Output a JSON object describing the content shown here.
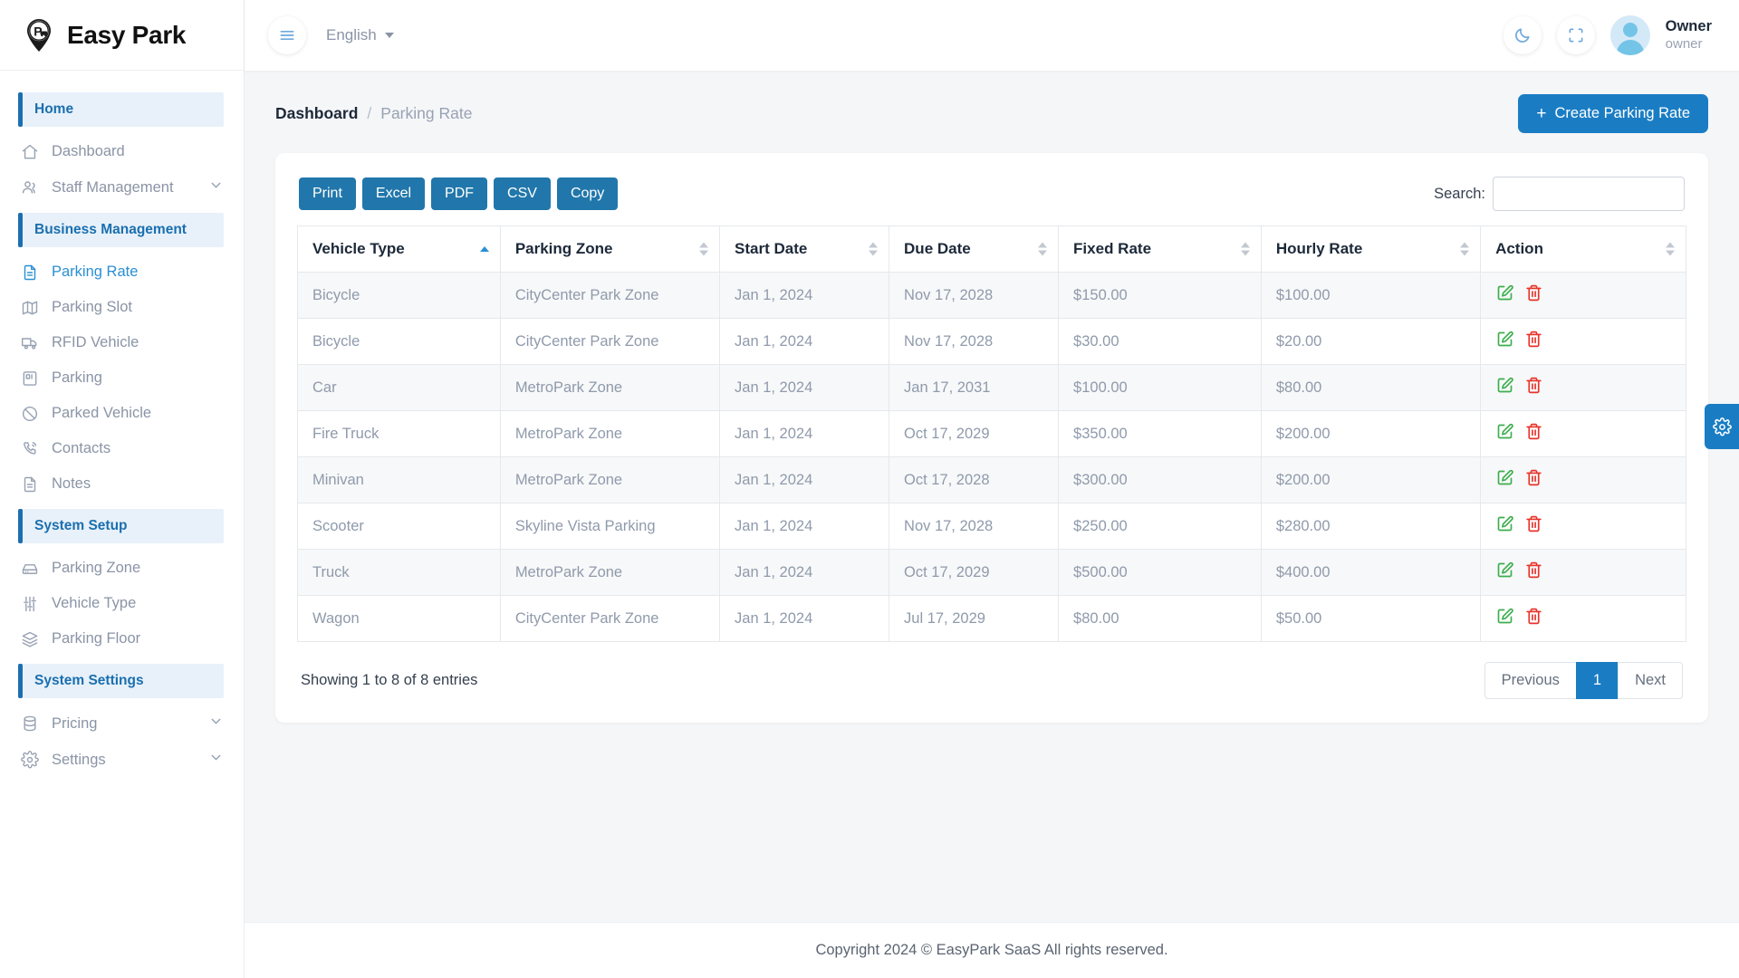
{
  "brand": {
    "name": "Easy Park",
    "logo_icon": "parking-pin-icon"
  },
  "topbar": {
    "menu_icon": "hamburger-menu-icon",
    "language": "English",
    "dark_mode_icon": "moon-icon",
    "fullscreen_icon": "fullscreen-icon",
    "user_name": "Owner",
    "user_role": "owner"
  },
  "sidebar": {
    "groups": [
      {
        "title": "Home",
        "items": [
          {
            "label": "Dashboard",
            "icon": "home-icon",
            "active": false,
            "expandable": false
          },
          {
            "label": "Staff Management",
            "icon": "users-icon",
            "active": false,
            "expandable": true
          }
        ]
      },
      {
        "title": "Business Management",
        "items": [
          {
            "label": "Parking Rate",
            "icon": "file-text-icon",
            "active": true,
            "expandable": false
          },
          {
            "label": "Parking Slot",
            "icon": "map-icon",
            "active": false,
            "expandable": false
          },
          {
            "label": "RFID Vehicle",
            "icon": "truck-icon",
            "active": false,
            "expandable": false
          },
          {
            "label": "Parking",
            "icon": "parking-meter-icon",
            "active": false,
            "expandable": false
          },
          {
            "label": "Parked Vehicle",
            "icon": "ban-icon",
            "active": false,
            "expandable": false
          },
          {
            "label": "Contacts",
            "icon": "phone-call-icon",
            "active": false,
            "expandable": false
          },
          {
            "label": "Notes",
            "icon": "file-text-icon",
            "active": false,
            "expandable": false
          }
        ]
      },
      {
        "title": "System Setup",
        "items": [
          {
            "label": "Parking Zone",
            "icon": "hard-drive-icon",
            "active": false,
            "expandable": false
          },
          {
            "label": "Vehicle Type",
            "icon": "sliders-icon",
            "active": false,
            "expandable": false
          },
          {
            "label": "Parking Floor",
            "icon": "layers-icon",
            "active": false,
            "expandable": false
          }
        ]
      },
      {
        "title": "System Settings",
        "items": [
          {
            "label": "Pricing",
            "icon": "database-icon",
            "active": false,
            "expandable": true
          },
          {
            "label": "Settings",
            "icon": "gear-icon",
            "active": false,
            "expandable": true
          }
        ]
      }
    ]
  },
  "page": {
    "breadcrumb_current": "Dashboard",
    "breadcrumb_sep": "/",
    "breadcrumb_sub": "Parking Rate",
    "create_button": "Create Parking Rate",
    "create_plus": "+"
  },
  "toolbar": {
    "buttons": [
      "Print",
      "Excel",
      "PDF",
      "CSV",
      "Copy"
    ],
    "search_label": "Search:",
    "search_value": "",
    "search_placeholder": ""
  },
  "table": {
    "columns": [
      {
        "label": "Vehicle Type",
        "sorted": "asc"
      },
      {
        "label": "Parking Zone",
        "sorted": "none"
      },
      {
        "label": "Start Date",
        "sorted": "none"
      },
      {
        "label": "Due Date",
        "sorted": "none"
      },
      {
        "label": "Fixed Rate",
        "sorted": "none"
      },
      {
        "label": "Hourly Rate",
        "sorted": "none"
      },
      {
        "label": "Action",
        "sorted": "none"
      }
    ],
    "rows": [
      {
        "vehicle_type": "Bicycle",
        "parking_zone": "CityCenter Park Zone",
        "start_date": "Jan 1, 2024",
        "due_date": "Nov 17, 2028",
        "fixed_rate": "$150.00",
        "hourly_rate": "$100.00"
      },
      {
        "vehicle_type": "Bicycle",
        "parking_zone": "CityCenter Park Zone",
        "start_date": "Jan 1, 2024",
        "due_date": "Nov 17, 2028",
        "fixed_rate": "$30.00",
        "hourly_rate": "$20.00"
      },
      {
        "vehicle_type": "Car",
        "parking_zone": "MetroPark Zone",
        "start_date": "Jan 1, 2024",
        "due_date": "Jan 17, 2031",
        "fixed_rate": "$100.00",
        "hourly_rate": "$80.00"
      },
      {
        "vehicle_type": "Fire Truck",
        "parking_zone": "MetroPark Zone",
        "start_date": "Jan 1, 2024",
        "due_date": "Oct 17, 2029",
        "fixed_rate": "$350.00",
        "hourly_rate": "$200.00"
      },
      {
        "vehicle_type": "Minivan",
        "parking_zone": "MetroPark Zone",
        "start_date": "Jan 1, 2024",
        "due_date": "Oct 17, 2028",
        "fixed_rate": "$300.00",
        "hourly_rate": "$200.00"
      },
      {
        "vehicle_type": "Scooter",
        "parking_zone": "Skyline Vista Parking",
        "start_date": "Jan 1, 2024",
        "due_date": "Nov 17, 2028",
        "fixed_rate": "$250.00",
        "hourly_rate": "$280.00"
      },
      {
        "vehicle_type": "Truck",
        "parking_zone": "MetroPark Zone",
        "start_date": "Jan 1, 2024",
        "due_date": "Oct 17, 2029",
        "fixed_rate": "$500.00",
        "hourly_rate": "$400.00"
      },
      {
        "vehicle_type": "Wagon",
        "parking_zone": "CityCenter Park Zone",
        "start_date": "Jan 1, 2024",
        "due_date": "Jul 17, 2029",
        "fixed_rate": "$80.00",
        "hourly_rate": "$50.00"
      }
    ],
    "row_actions": {
      "edit_icon": "edit-pencil-icon",
      "delete_icon": "trash-icon"
    }
  },
  "pagination": {
    "entries_text": "Showing 1 to 8 of 8 entries",
    "previous": "Previous",
    "current_page": "1",
    "next": "Next"
  },
  "footer": {
    "text": "Copyright 2024 © EasyPark SaaS All rights reserved."
  },
  "settings_tab": {
    "icon": "gear-icon"
  },
  "colors": {
    "accent": "#1a7dc4",
    "toolbar_button": "#2177ab",
    "edit_green": "#3dae4e",
    "delete_red": "#e8332a",
    "group_bg": "#e8f1fa"
  }
}
